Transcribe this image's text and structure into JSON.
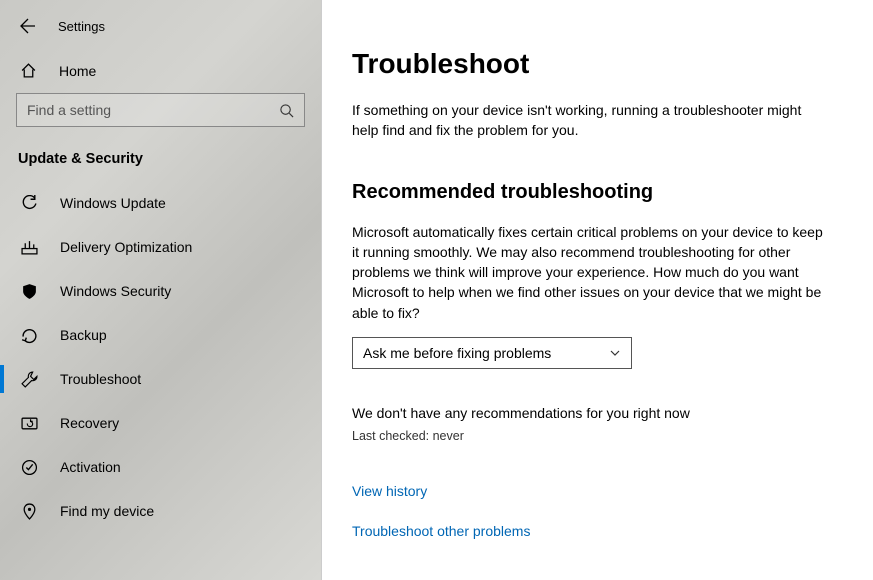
{
  "header": {
    "title": "Settings"
  },
  "home": {
    "label": "Home"
  },
  "search": {
    "placeholder": "Find a setting"
  },
  "section": {
    "title": "Update & Security"
  },
  "nav": {
    "items": [
      {
        "label": "Windows Update"
      },
      {
        "label": "Delivery Optimization"
      },
      {
        "label": "Windows Security"
      },
      {
        "label": "Backup"
      },
      {
        "label": "Troubleshoot"
      },
      {
        "label": "Recovery"
      },
      {
        "label": "Activation"
      },
      {
        "label": "Find my device"
      }
    ]
  },
  "main": {
    "title": "Troubleshoot",
    "lead": "If something on your device isn't working, running a troubleshooter might help find and fix the problem for you.",
    "h2": "Recommended troubleshooting",
    "para": "Microsoft automatically fixes certain critical problems on your device to keep it running smoothly. We may also recommend troubleshooting for other problems we think will improve your experience. How much do you want Microsoft to help when we find other issues on your device that we might be able to fix?",
    "dropdown": {
      "selected": "Ask me before fixing problems"
    },
    "status": "We don't have any recommendations for you right now",
    "checked": "Last checked: never",
    "links": {
      "history": "View history",
      "other": "Troubleshoot other problems"
    }
  }
}
